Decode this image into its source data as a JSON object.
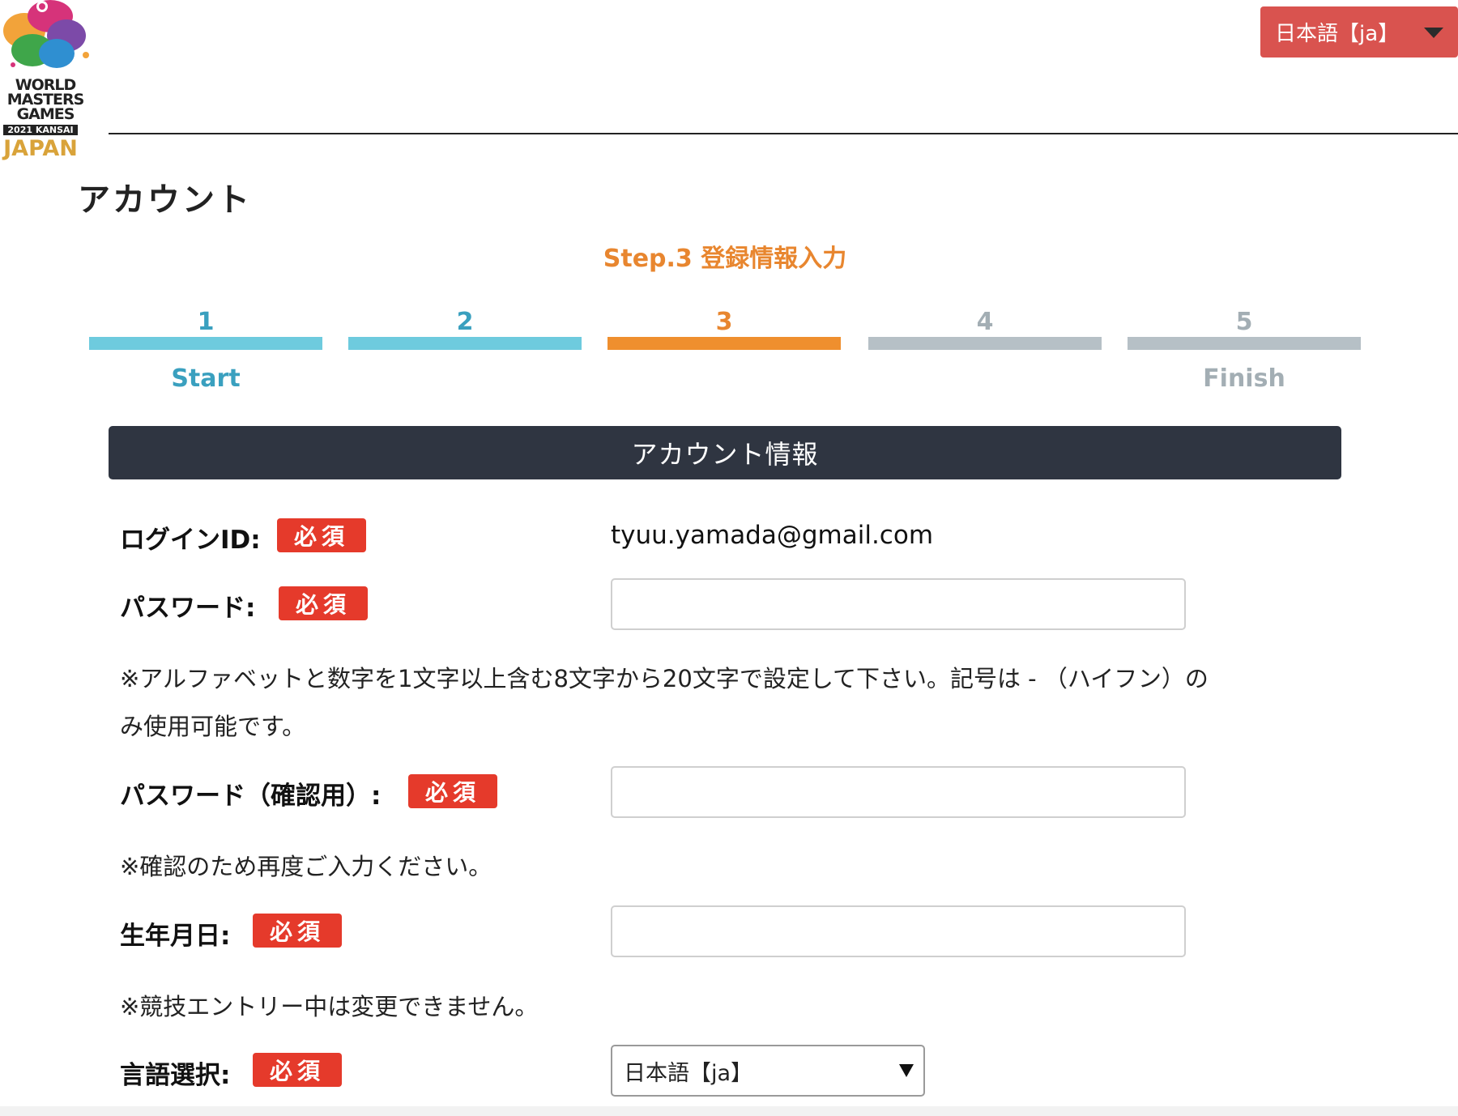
{
  "logo": {
    "line1": "WORLD",
    "line2": "MASTERS",
    "line3": "GAMES",
    "line4": "2021 KANSAI",
    "line5": "JAPAN"
  },
  "language_top": {
    "selected": "日本語【ja】"
  },
  "page_title": "アカウント",
  "step_label": "Step.3 登録情報入力",
  "steps": [
    {
      "number": "1",
      "caption": "Start",
      "color": "#6ecbde",
      "text_color": "#3aa0bf"
    },
    {
      "number": "2",
      "caption": "",
      "color": "#6ecbde",
      "text_color": "#3aa0bf"
    },
    {
      "number": "3",
      "caption": "",
      "color": "#ef8f2e",
      "text_color": "#e8862f"
    },
    {
      "number": "4",
      "caption": "",
      "color": "#b6c0c6",
      "text_color": "#a3aeb4"
    },
    {
      "number": "5",
      "caption": "Finish",
      "color": "#b6c0c6",
      "text_color": "#a3aeb4"
    }
  ],
  "panel_title": "アカウント情報",
  "required_badge": "必須",
  "login": {
    "label": "ログインID:",
    "value": "tyuu.yamada@gmail.com"
  },
  "password": {
    "label": "パスワード:",
    "value": "",
    "note_line1": "※アルファベットと数字を1文字以上含む8文字から20文字で設定して下さい。記号は - （ハイフン）の",
    "note_line2": "み使用可能です。"
  },
  "password_confirm": {
    "label": "パスワード（確認用）:",
    "value": "",
    "note": "※確認のため再度ご入力ください。"
  },
  "birthdate": {
    "label": "生年月日:",
    "value": "",
    "note": "※競技エントリー中は変更できません。"
  },
  "language": {
    "label": "言語選択:",
    "selected": "日本語【ja】"
  }
}
